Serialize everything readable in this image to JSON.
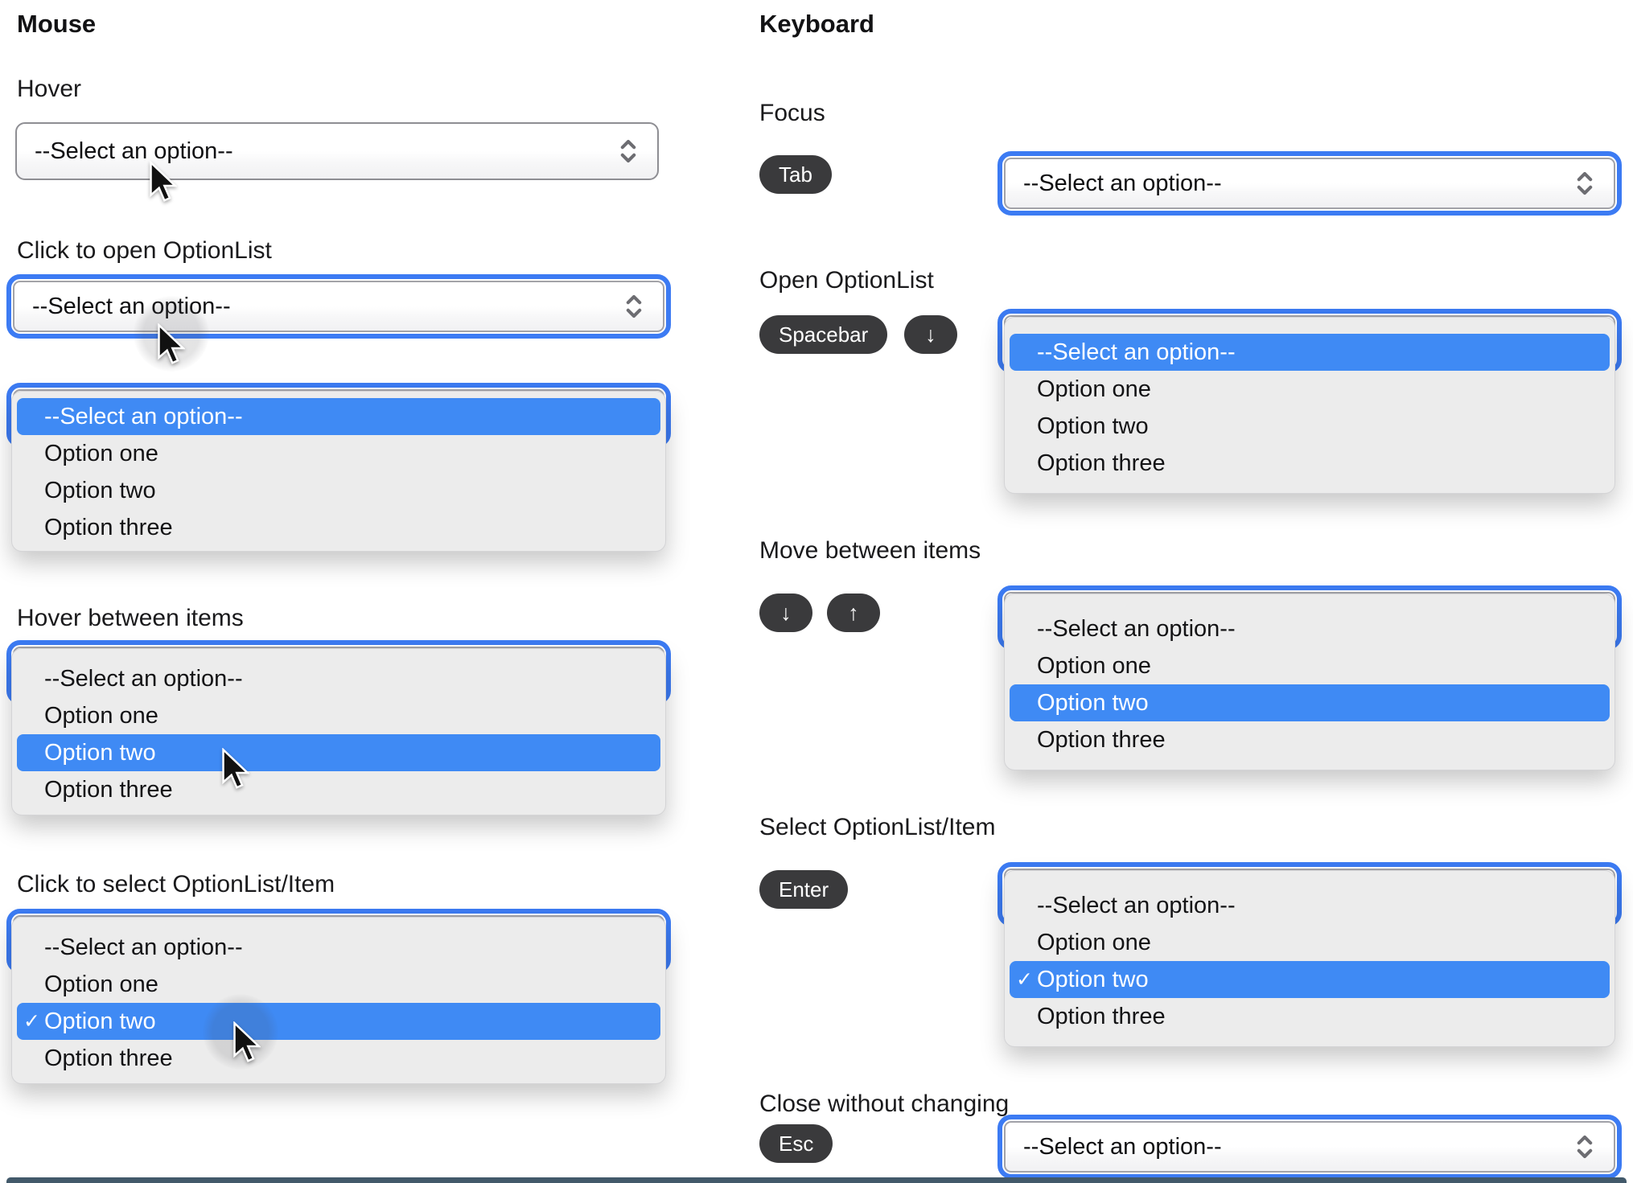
{
  "columns": {
    "mouse_heading": "Mouse",
    "keyboard_heading": "Keyboard"
  },
  "labels": {
    "hover": "Hover",
    "click_open": "Click to open OptionList",
    "hover_between": "Hover between items",
    "click_select": "Click to select OptionList/Item",
    "focus": "Focus",
    "open_optionlist": "Open OptionList",
    "move_between": "Move between items",
    "select_item": "Select OptionList/Item",
    "close_without": "Close without changing"
  },
  "keys": {
    "tab": "Tab",
    "spacebar": "Spacebar",
    "enter": "Enter",
    "esc": "Esc",
    "down": "↓",
    "up": "↑"
  },
  "select": {
    "placeholder": "--Select an option--"
  },
  "options": {
    "placeholder": "--Select an option--",
    "one": "Option one",
    "two": "Option two",
    "three": "Option three"
  },
  "glyphs": {
    "check": "✓"
  },
  "colors": {
    "focus_ring": "#3c7bf3",
    "highlight": "#3f8af4",
    "key_pill": "#3a3a3c",
    "popup_bg": "#ececec"
  }
}
